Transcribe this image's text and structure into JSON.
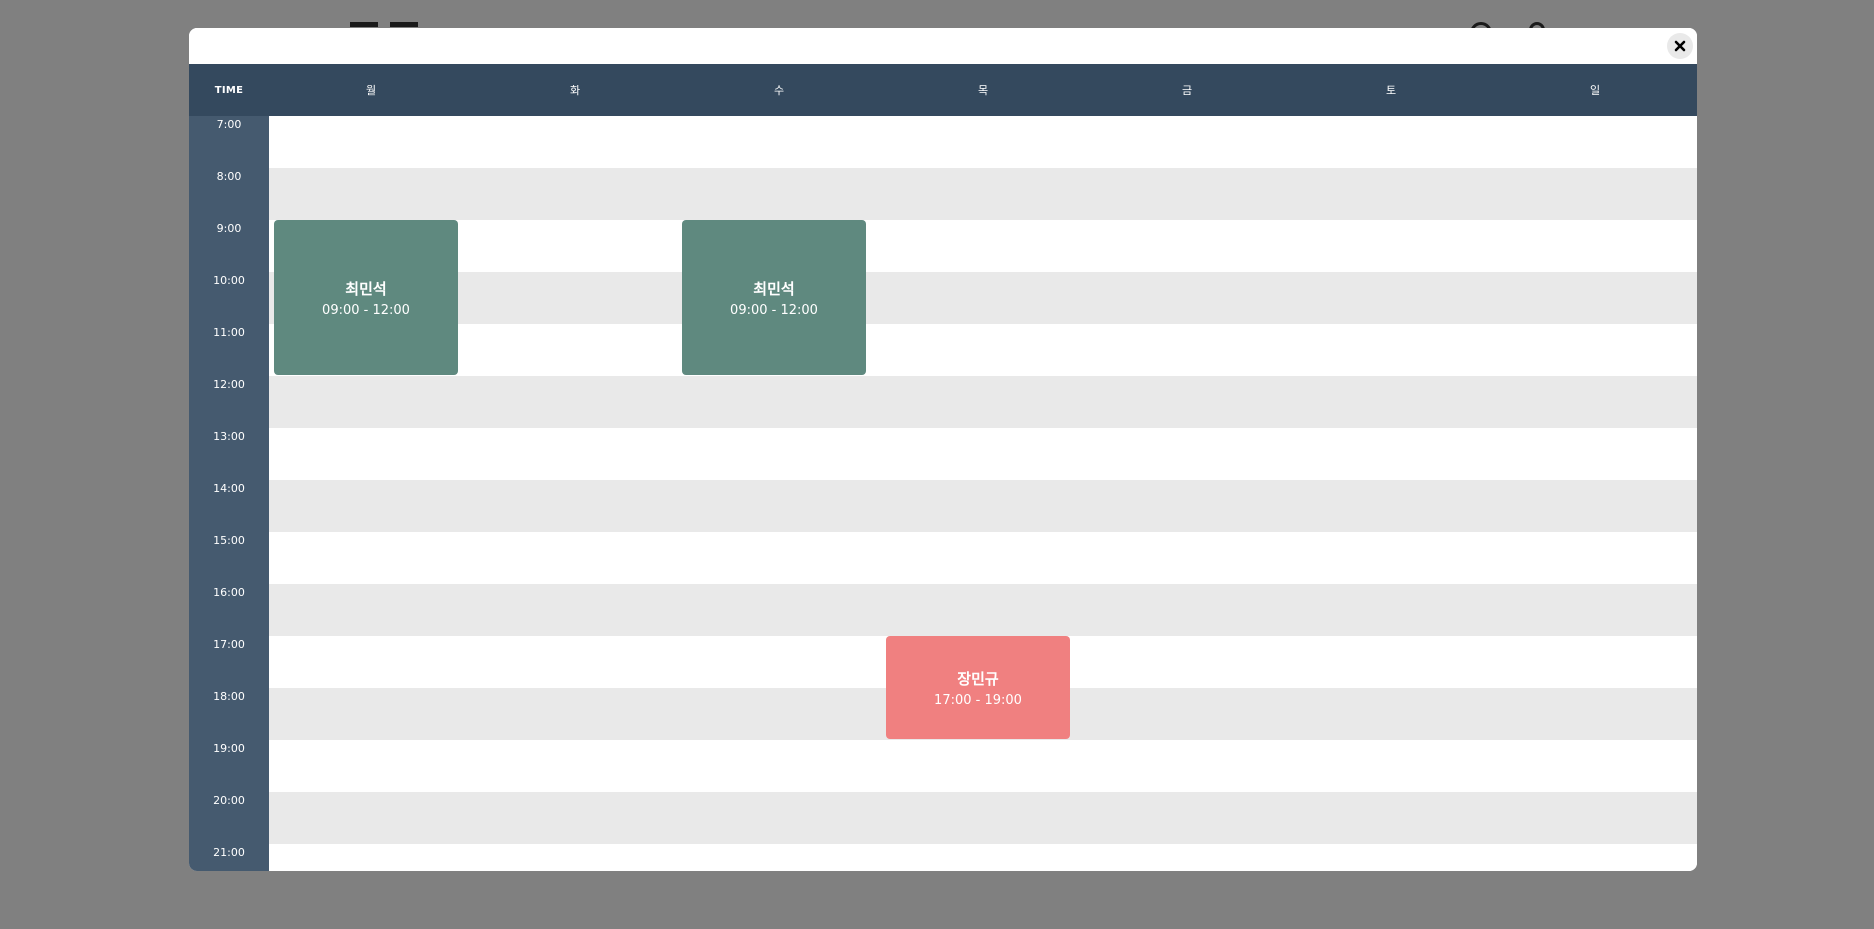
{
  "modal": {
    "close_icon": "close-icon"
  },
  "header": {
    "time_label": "TIME",
    "days": [
      "월",
      "화",
      "수",
      "목",
      "금",
      "토",
      "일"
    ]
  },
  "times": [
    "7:00",
    "8:00",
    "9:00",
    "10:00",
    "11:00",
    "12:00",
    "13:00",
    "14:00",
    "15:00",
    "16:00",
    "17:00",
    "18:00",
    "19:00",
    "20:00",
    "21:00"
  ],
  "events": [
    {
      "name": "최민석",
      "time": "09:00 - 12:00",
      "day": 0,
      "start": 9,
      "end": 12,
      "color": "#5f897f"
    },
    {
      "name": "최민석",
      "time": "09:00 - 12:00",
      "day": 2,
      "start": 9,
      "end": 12,
      "color": "#5f897f"
    },
    {
      "name": "장민규",
      "time": "17:00 - 19:00",
      "day": 3,
      "start": 17,
      "end": 19,
      "color": "#f08080"
    }
  ],
  "colors": {
    "overlay": "#808080",
    "header": "#34495e",
    "time_column": "#455a6f",
    "stripe": "#e9e9e9"
  }
}
